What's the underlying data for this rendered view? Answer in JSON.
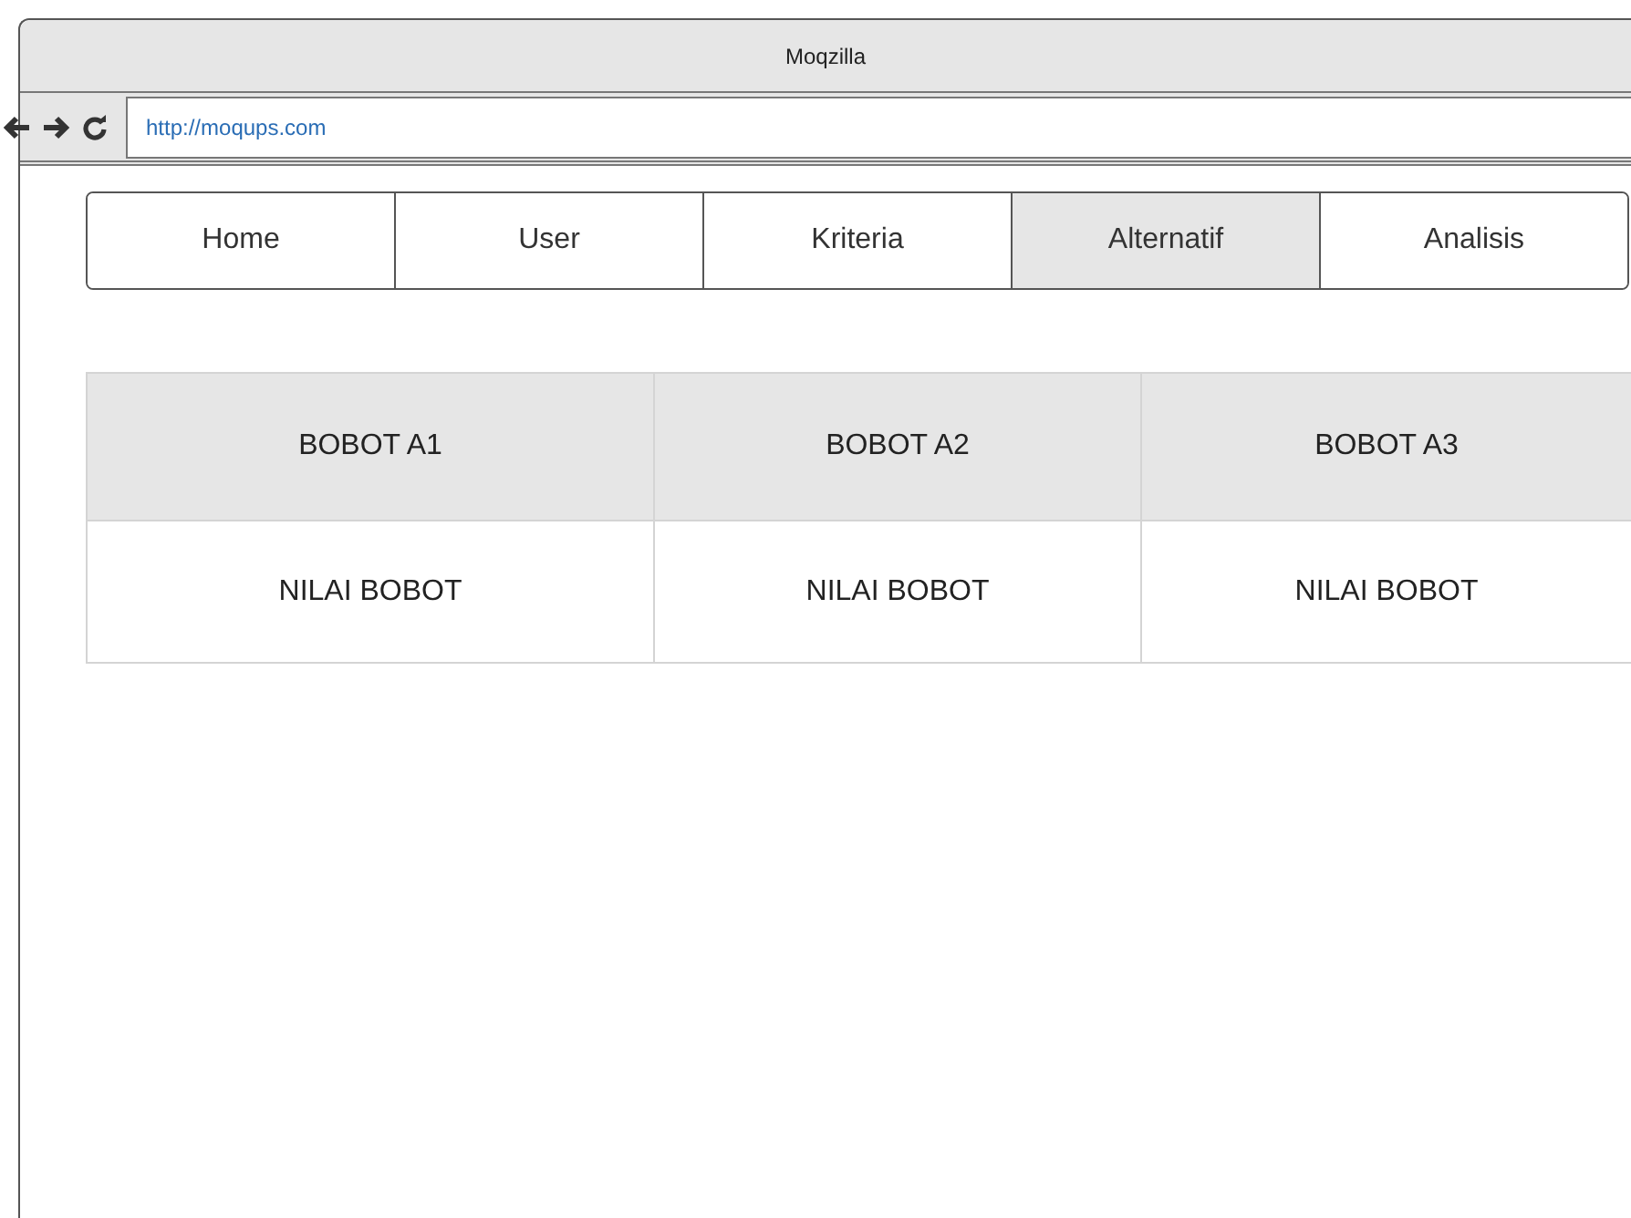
{
  "window": {
    "title": "Moqzilla"
  },
  "address_bar": {
    "value": "http://moqups.com"
  },
  "tabs": [
    {
      "label": "Home",
      "selected": false
    },
    {
      "label": "User",
      "selected": false
    },
    {
      "label": "Kriteria",
      "selected": false
    },
    {
      "label": "Alternatif",
      "selected": true
    },
    {
      "label": "Analisis",
      "selected": false
    }
  ],
  "table": {
    "columns": [
      "BOBOT A1",
      "BOBOT A2",
      "BOBOT A3"
    ],
    "rows": [
      [
        "NILAI BOBOT",
        "NILAI BOBOT",
        "NILAI BOBOT"
      ]
    ]
  }
}
